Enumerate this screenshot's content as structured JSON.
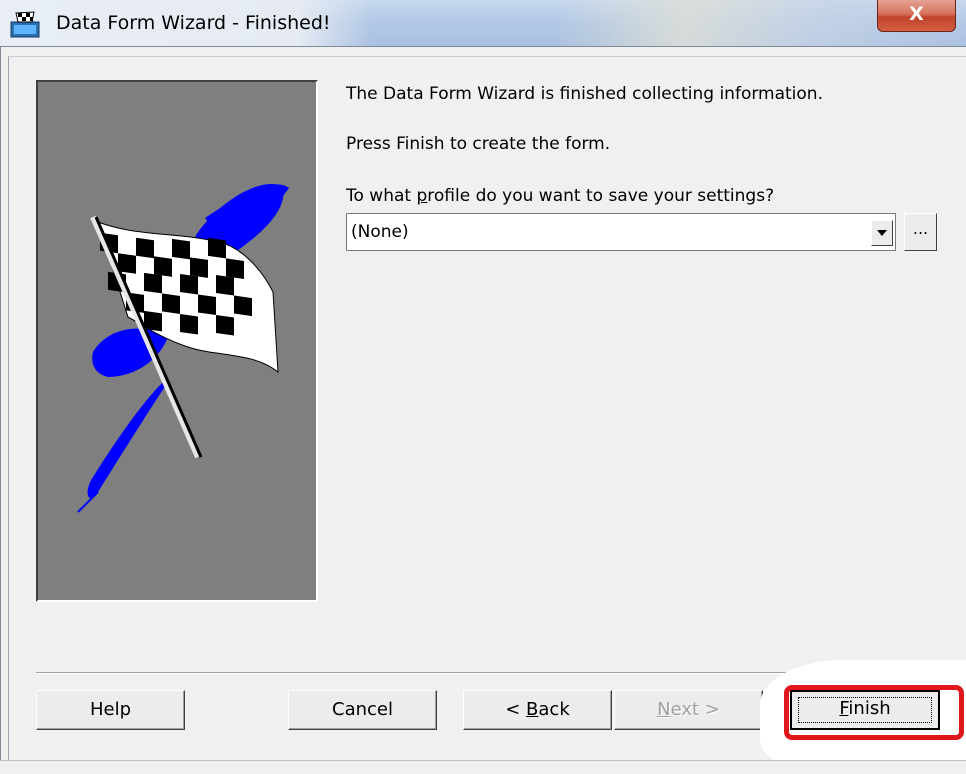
{
  "window": {
    "title": "Data Form Wizard - Finished!",
    "close_label": "X"
  },
  "content": {
    "line1": "The Data Form Wizard is finished collecting information.",
    "line2": "Press Finish to create the form.",
    "profile_label_pre": "To what ",
    "profile_label_accel": "p",
    "profile_label_post": "rofile do you want to save your settings?",
    "profile_value": "(None)",
    "ellipsis_label": "..."
  },
  "buttons": {
    "help": "Help",
    "cancel": "Cancel",
    "back_pre": "< ",
    "back_accel": "B",
    "back_post": "ack",
    "next_accel": "N",
    "next_post": "ext >",
    "finish_accel": "F",
    "finish_post": "inish"
  },
  "colors": {
    "highlight": "#e0181e",
    "picture_bg": "#7f7f7f",
    "flag_blue": "#0000ff"
  },
  "icons": {
    "app": "wizard-flag-icon",
    "picture": "checkered-flag-icon"
  }
}
